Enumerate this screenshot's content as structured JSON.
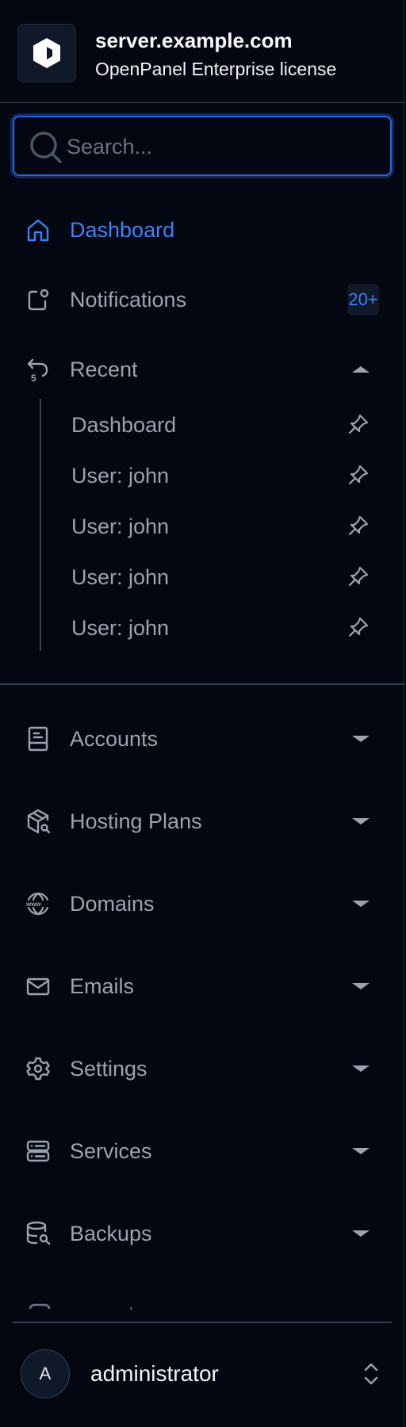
{
  "header": {
    "title": "server.example.com",
    "subtitle": "OpenPanel Enterprise license",
    "logo_icon": "openpanel-logo-icon"
  },
  "search": {
    "placeholder": "Search...",
    "value": ""
  },
  "nav_top": [
    {
      "label": "Dashboard",
      "icon": "home-icon",
      "active": true
    },
    {
      "label": "Notifications",
      "icon": "notification-icon",
      "badge": "20+"
    },
    {
      "label": "Recent",
      "icon": "history-icon",
      "expanded": true
    }
  ],
  "recent_items": [
    {
      "label": "Dashboard",
      "icon": "pin-icon"
    },
    {
      "label": "User: john",
      "icon": "pin-icon"
    },
    {
      "label": "User: john",
      "icon": "pin-icon"
    },
    {
      "label": "User: john",
      "icon": "pin-icon"
    },
    {
      "label": "User: john",
      "icon": "pin-icon"
    }
  ],
  "nav_sections": [
    {
      "label": "Accounts",
      "icon": "address-book-icon"
    },
    {
      "label": "Hosting Plans",
      "icon": "package-search-icon"
    },
    {
      "label": "Domains",
      "icon": "world-www-icon"
    },
    {
      "label": "Emails",
      "icon": "mail-icon"
    },
    {
      "label": "Settings",
      "icon": "gear-icon"
    },
    {
      "label": "Services",
      "icon": "server-icon"
    },
    {
      "label": "Backups",
      "icon": "database-search-icon"
    }
  ],
  "footer": {
    "avatar_initial": "A",
    "user": "administrator"
  },
  "colors": {
    "background": "#030712",
    "accent": "#3b82f6",
    "search_border": "#2563eb",
    "muted_text": "#9ca3af",
    "border": "#374151"
  }
}
